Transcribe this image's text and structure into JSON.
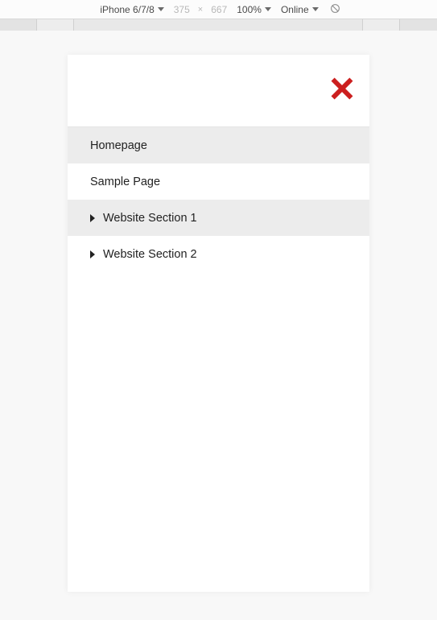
{
  "devtools": {
    "device": "iPhone 6/7/8",
    "width": "375",
    "height": "667",
    "zoom": "100%",
    "network": "Online"
  },
  "menu": {
    "items": [
      {
        "label": "Homepage",
        "expandable": false,
        "shaded": true
      },
      {
        "label": "Sample Page",
        "expandable": false,
        "shaded": false
      },
      {
        "label": "Website Section 1",
        "expandable": true,
        "shaded": true
      },
      {
        "label": "Website Section 2",
        "expandable": true,
        "shaded": false
      }
    ]
  }
}
